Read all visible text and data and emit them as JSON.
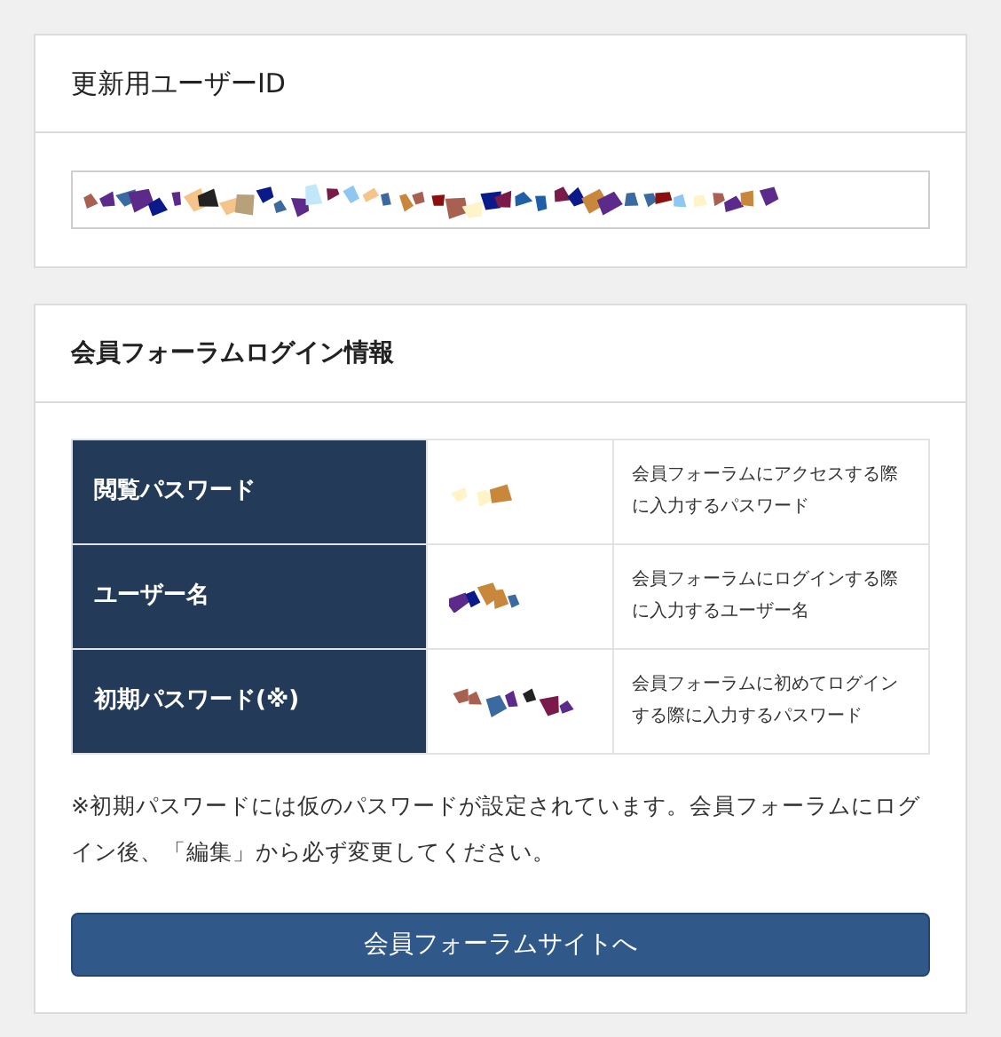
{
  "user_id_card": {
    "title": "更新用ユーザーID"
  },
  "login_card": {
    "title": "会員フォーラムログイン情報",
    "rows": [
      {
        "label": "閲覧パスワード",
        "description": "会員フォーラムにアクセスする際に入力するパスワード"
      },
      {
        "label": "ユーザー名",
        "description": "会員フォーラムにログインする際に入力するユーザー名"
      },
      {
        "label": "初期パスワード(※)",
        "description": "会員フォーラムに初めてログインする際に入力するパスワード"
      }
    ],
    "note": "※初期パスワードには仮のパスワードが設定されています。会員フォーラムにログイン後、「編集」から必ず変更してください。",
    "button": "会員フォーラムサイトへ"
  }
}
